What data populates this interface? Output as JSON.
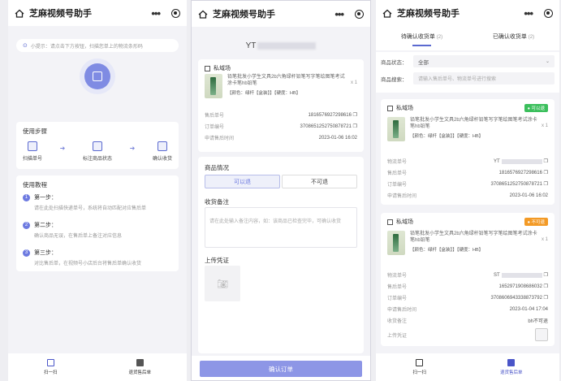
{
  "app_title": "芝麻视频号助手",
  "panel1": {
    "tip": "小提示：请点击下方按钮，扫描您单上的物流条形码",
    "steps_heading": "使用步骤",
    "steps": [
      {
        "label": "扫描单号"
      },
      {
        "label": "标注商品状态"
      },
      {
        "label": "确认收货"
      }
    ],
    "tutorial_heading": "使用教程",
    "tutorial": [
      {
        "num": "1",
        "title": "第一步：",
        "desc": "请在此处扫描快递单号，系统将自动匹配对应售后单"
      },
      {
        "num": "2",
        "title": "第二步：",
        "desc": "确认商品无误，在售后单上备注对应信息"
      },
      {
        "num": "3",
        "title": "第三步：",
        "desc": "对比售后单，在视频号小店后台将售后单确认收货"
      }
    ],
    "bottom": [
      {
        "label": "扫一扫"
      },
      {
        "label": "退货售后单"
      }
    ]
  },
  "panel2": {
    "tracking": "YT",
    "shop": "私域场",
    "product": "铅笔批发小学生文具2b六角绿杆铅笔写字笔绘图笔考试涂卡笔hb铅笔",
    "qty": "x 1",
    "spec": "【颜色：绿杆【盒装】】【硬度：HB】",
    "fields": [
      {
        "k": "售后单号",
        "v": "1816576927298616"
      },
      {
        "k": "订单编号",
        "v": "3708651252750878721"
      },
      {
        "k": "申请售后时间",
        "v": "2023-01-06 16:02"
      }
    ],
    "condition_heading": "商品情况",
    "opt_returnable": "可以退",
    "opt_not_returnable": "不可退",
    "remark_heading": "收货备注",
    "remark_placeholder": "请在此处输入备注内容，如：该商品已检查完毕，可确认收货",
    "voucher_heading": "上传凭证",
    "confirm": "确认订单"
  },
  "panel3": {
    "tabs": [
      {
        "label": "待确认收货单",
        "count": "(2)"
      },
      {
        "label": "已确认收货单",
        "count": "(2)"
      }
    ],
    "status_label": "商品状态：",
    "status_value": "全部",
    "search_label": "商品搜索：",
    "search_placeholder": "请输入售后单号、物流单号进行搜索",
    "orders": [
      {
        "shop": "私域场",
        "badge": "可以退",
        "badge_color": "#3bbf5c",
        "product": "铅笔批发小学生文具2b六角绿杆铅笔写字笔绘图笔考试涂卡笔hb铅笔",
        "qty": "x 1",
        "spec": "【颜色：绿杆【盒装】】【硬度：HB】",
        "fields": [
          {
            "k": "物流单号",
            "v": "YT"
          },
          {
            "k": "售后单号",
            "v": "1816576927298616"
          },
          {
            "k": "订单编号",
            "v": "3708651252750878721"
          },
          {
            "k": "申请售后时间",
            "v": "2023-01-06 16:02"
          }
        ]
      },
      {
        "shop": "私域场",
        "badge": "不可退",
        "badge_color": "#f39a26",
        "product": "铅笔批发小学生文具2b六角绿杆铅笔写字笔绘图笔考试涂卡笔hb铅笔",
        "qty": "x 1",
        "spec": "【颜色：绿杆【盒装】】【硬度：HB】",
        "fields": [
          {
            "k": "物流单号",
            "v": "ST"
          },
          {
            "k": "售后单号",
            "v": "1652971908686032"
          },
          {
            "k": "订单编号",
            "v": "3708606943338873792"
          },
          {
            "k": "申请售后时间",
            "v": "2023-01-04 17:04"
          },
          {
            "k": "收货备注",
            "v": "bh不可退"
          },
          {
            "k": "上传凭证",
            "v": ""
          }
        ]
      }
    ],
    "bottom": [
      {
        "label": "扫一扫"
      },
      {
        "label": "退货售后单"
      }
    ]
  },
  "colors": {
    "accent": "#5b6ad0",
    "button": "#8d96e6",
    "green": "#3bbf5c",
    "orange": "#f39a26"
  }
}
